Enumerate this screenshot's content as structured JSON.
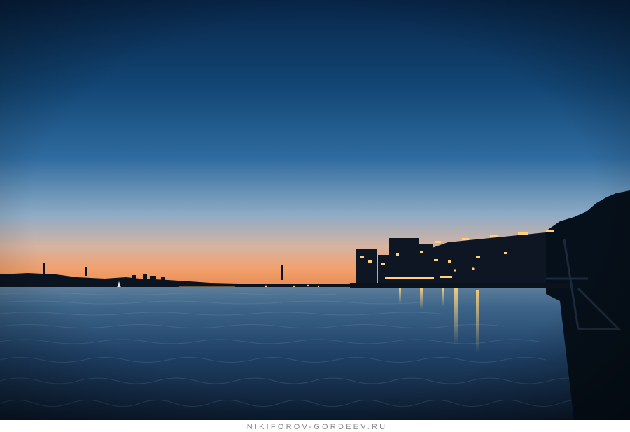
{
  "photo": {
    "subject": "",
    "colors": {
      "sky_top": "#0b2f55",
      "sky_mid": "#1c5a8d",
      "sky_low": "#7fa4c7",
      "horizon_glow": "#f1a36c",
      "water_dark": "#0c1a2b",
      "water_mid": "#22466b",
      "light_warm": "#ffd27a"
    }
  },
  "watermark": {
    "text": "NIKIFOROV-GORDEEV.RU",
    "colors": {
      "text": "#8a8a8a",
      "accent": "#f4a21b"
    }
  }
}
